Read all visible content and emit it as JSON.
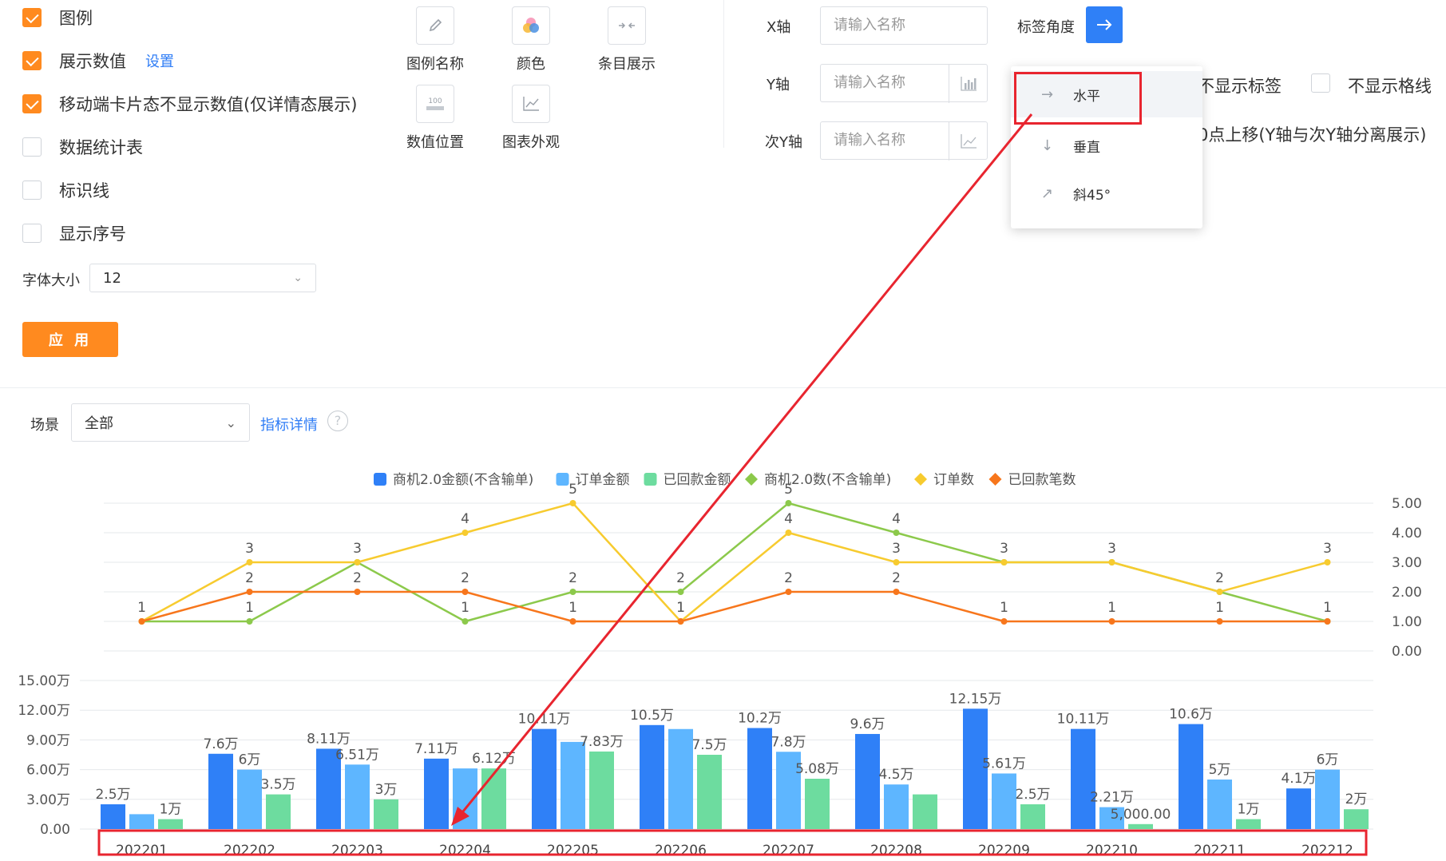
{
  "options": {
    "items": [
      {
        "label": "图例",
        "checked": true
      },
      {
        "label": "展示数值",
        "checked": true,
        "link": "设置"
      },
      {
        "label": "移动端卡片态不显示数值(仅详情态展示)",
        "checked": true
      },
      {
        "label": "数据统计表",
        "checked": false
      },
      {
        "label": "标识线",
        "checked": false
      },
      {
        "label": "显示序号",
        "checked": false
      }
    ],
    "font_size_label": "字体大小",
    "font_size_value": "12",
    "apply_label": "应 用"
  },
  "tools": [
    {
      "label": "图例名称",
      "icon": "pencil-icon"
    },
    {
      "label": "颜色",
      "icon": "color-palette-icon"
    },
    {
      "label": "条目展示",
      "icon": "collapse-arrows-icon"
    },
    {
      "label": "数值位置",
      "icon": "value-position-icon"
    },
    {
      "label": "图表外观",
      "icon": "line-chart-icon"
    }
  ],
  "axis_settings": {
    "x_label": "X轴",
    "y_label": "Y轴",
    "y2_label": "次Y轴",
    "placeholder": "请输入名称",
    "angle_label": "标签角度",
    "angle_options": [
      {
        "label": "水平",
        "icon": "arrow-right-icon"
      },
      {
        "label": "垂直",
        "icon": "arrow-down-icon"
      },
      {
        "label": "斜45°",
        "icon": "arrow-diagonal-icon"
      }
    ],
    "hide_labels": "不显示标签",
    "hide_gridlines": "不显示格线",
    "zero_shift_partial": "0点上移(Y轴与次Y轴分离展示)"
  },
  "filter": {
    "scene_label": "场景",
    "scene_value": "全部",
    "detail_link": "指标详情",
    "help_icon": "?"
  },
  "colors": {
    "accent": "#ff8a1f",
    "primary_blue": "#2f7df6",
    "highlight_red": "#e8252f"
  },
  "chart_data": {
    "type": "bar",
    "categories": [
      "202201",
      "202202",
      "202203",
      "202204",
      "202205",
      "202206",
      "202207",
      "202208",
      "202209",
      "202210",
      "202211",
      "202212"
    ],
    "bar_series": [
      {
        "name": "商机2.0金额(不含输单)",
        "color": "#2f80f7",
        "values": [
          2.5,
          7.6,
          8.11,
          7.11,
          10.11,
          10.5,
          10.2,
          9.6,
          12.15,
          10.11,
          10.6,
          4.1
        ],
        "labels": [
          "2.5万",
          "7.6万",
          "8.11万",
          "7.11万",
          "10.11万",
          "10.5万",
          "10.2万",
          "9.6万",
          "12.15万",
          "10.11万",
          "10.6万",
          "4.1万"
        ]
      },
      {
        "name": "订单金额",
        "color": "#5eb6ff",
        "values": [
          1.5,
          6,
          6.51,
          6.12,
          8.8,
          10.1,
          7.8,
          4.5,
          5.61,
          2.21,
          5,
          6
        ],
        "labels": [
          "",
          "6万",
          "6.51万",
          "",
          "",
          "",
          "7.8万",
          "4.5万",
          "5.61万",
          "2.21万",
          "5万",
          "6万"
        ]
      },
      {
        "name": "已回款金额",
        "color": "#6ddc9f",
        "values": [
          1,
          3.5,
          3,
          6.12,
          7.83,
          7.5,
          5.08,
          3.5,
          2.5,
          0.5,
          1,
          2
        ],
        "labels": [
          "1万",
          "3.5万",
          "3万",
          "6.12万",
          "7.83万",
          "7.5万",
          "5.08万",
          "",
          "2.5万",
          "5,000.00",
          "1万",
          "2万"
        ]
      }
    ],
    "line_series": [
      {
        "name": "商机2.0数(不含输单)",
        "color": "#8cc94b",
        "values": [
          1,
          1,
          3,
          1,
          2,
          2,
          5,
          4,
          3,
          3,
          2,
          1
        ]
      },
      {
        "name": "订单数",
        "color": "#f7cb2f",
        "values": [
          1,
          3,
          3,
          4,
          5,
          1,
          4,
          3,
          3,
          3,
          2,
          3
        ]
      },
      {
        "name": "已回款笔数",
        "color": "#f7761c",
        "values": [
          1,
          2,
          2,
          2,
          1,
          1,
          2,
          2,
          1,
          1,
          1,
          1
        ]
      }
    ],
    "line_point_labels": [
      [
        "1",
        "3",
        "3",
        "4",
        "5",
        "1",
        "5",
        "4",
        "3",
        "3",
        "2",
        "3"
      ],
      [
        "",
        "2",
        "2",
        "2",
        "2",
        "2",
        "4",
        "3",
        "",
        "",
        "",
        ""
      ],
      [
        "",
        "1",
        "",
        "1",
        "1",
        "1",
        "2",
        "2",
        "1",
        "1",
        "1",
        "1"
      ]
    ],
    "y_ticks_bar": [
      "0.00",
      "3.00万",
      "6.00万",
      "9.00万",
      "12.00万",
      "15.00万"
    ],
    "y_ticks_line": [
      "0.00",
      "1.00",
      "2.00",
      "3.00",
      "4.00",
      "5.00"
    ],
    "ylim_bar": [
      0,
      15
    ],
    "ylim_line": [
      0,
      5
    ],
    "legend_position": "top-center"
  }
}
